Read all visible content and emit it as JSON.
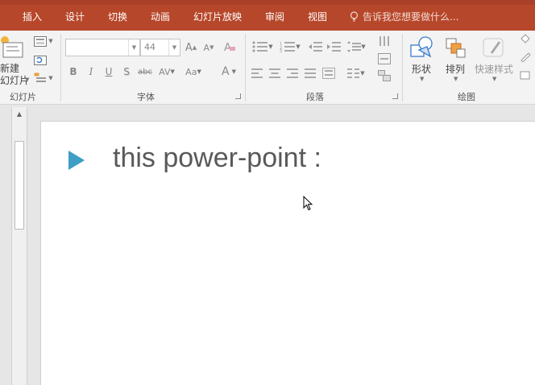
{
  "menu_tabs": [
    "插入",
    "设计",
    "切换",
    "动画",
    "幻灯片放映",
    "审阅",
    "视图"
  ],
  "tell_me": "告诉我您想要做什么...",
  "ribbon": {
    "slides": {
      "new_slide_line1": "新建",
      "new_slide_line2": "幻灯片",
      "group_label": "幻灯片"
    },
    "font": {
      "font_name_value": "",
      "font_size_value": "44",
      "group_label": "字体"
    },
    "paragraph": {
      "group_label": "段落"
    },
    "drawing": {
      "shapes_label": "形状",
      "arrange_label": "排列",
      "quick_styles_label": "快速样式",
      "group_label": "绘图"
    }
  },
  "slide": {
    "bullet_text": "this power-point  :"
  },
  "colors": {
    "tab_bar": "#b7472a",
    "bullet": "#3d9ec6",
    "slide_text": "#595959"
  }
}
